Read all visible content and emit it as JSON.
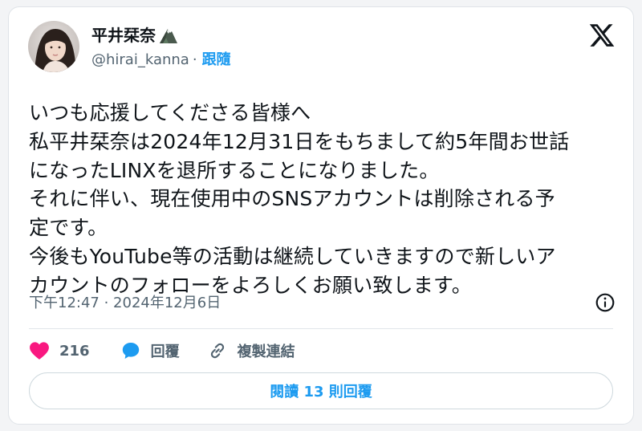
{
  "author": {
    "display_name": "平井栞奈",
    "handle": "@hirai_kanna",
    "separator": "·",
    "follow_label": "跟隨"
  },
  "tweet": {
    "lines": [
      "いつも応援してくださる皆様へ",
      "私平井栞奈は2024年12月31日をもちまして約5年間お世話",
      "になったLINXを退所することになりました。",
      "それに伴い、現在使用中のSNSアカウントは削除される予",
      "定です。",
      "今後もYouTube等の活動は継続していきますので新しいア",
      "カウントのフォローをよろしくお願い致します。"
    ],
    "timestamp": "下午12:47 · 2024年12月6日"
  },
  "actions": {
    "like_count": "216",
    "reply_label": "回覆",
    "copy_link_label": "複製連結"
  },
  "read_replies_label": "閱讀 13 則回覆",
  "colors": {
    "accent": "#1d9bf0",
    "like": "#f91880",
    "text": "#0f1419",
    "secondary": "#536471"
  },
  "icons": [
    "x-logo-icon",
    "mountain-emoji-icon",
    "info-icon",
    "heart-icon",
    "reply-bubble-icon",
    "link-icon"
  ]
}
